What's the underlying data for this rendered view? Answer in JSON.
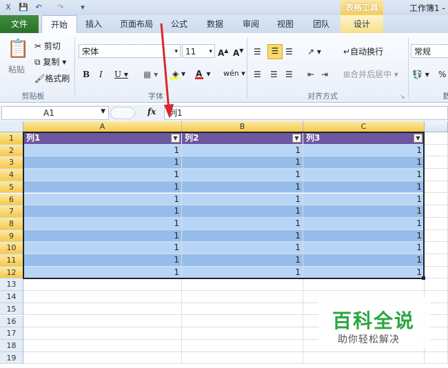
{
  "title_bar": {
    "context_group": "表格工具",
    "window_title": "工作簿1 -"
  },
  "tabs": [
    "文件",
    "开始",
    "插入",
    "页面布局",
    "公式",
    "数据",
    "审阅",
    "视图",
    "团队",
    "设计"
  ],
  "clipboard": {
    "paste": "粘贴",
    "cut": "剪切",
    "copy": "复制",
    "format_painter": "格式刷",
    "group": "剪贴板"
  },
  "font": {
    "name": "宋体",
    "size": "11",
    "group": "字体"
  },
  "alignment": {
    "wrap": "自动换行",
    "merge": "合并后居中",
    "group": "对齐方式"
  },
  "number": {
    "format": "常规",
    "percent": "%",
    "group": "数"
  },
  "formula_bar": {
    "cell_ref": "A1",
    "fx": "fx",
    "content": "列1"
  },
  "columns": [
    "A",
    "B",
    "C"
  ],
  "table": {
    "headers": [
      "列1",
      "列2",
      "列3"
    ],
    "rows": [
      [
        "1",
        "1",
        "1"
      ],
      [
        "1",
        "1",
        "1"
      ],
      [
        "1",
        "1",
        "1"
      ],
      [
        "1",
        "1",
        "1"
      ],
      [
        "1",
        "1",
        "1"
      ],
      [
        "1",
        "1",
        "1"
      ],
      [
        "1",
        "1",
        "1"
      ],
      [
        "1",
        "1",
        "1"
      ],
      [
        "1",
        "1",
        "1"
      ],
      [
        "1",
        "1",
        "1"
      ],
      [
        "1",
        "1",
        "1"
      ]
    ]
  },
  "row_numbers": [
    "1",
    "2",
    "3",
    "4",
    "5",
    "6",
    "7",
    "8",
    "9",
    "10",
    "11",
    "12",
    "13",
    "14",
    "15",
    "16",
    "17",
    "18",
    "19"
  ],
  "watermark": {
    "main": "百科全说",
    "sub": "助你轻松解决"
  }
}
